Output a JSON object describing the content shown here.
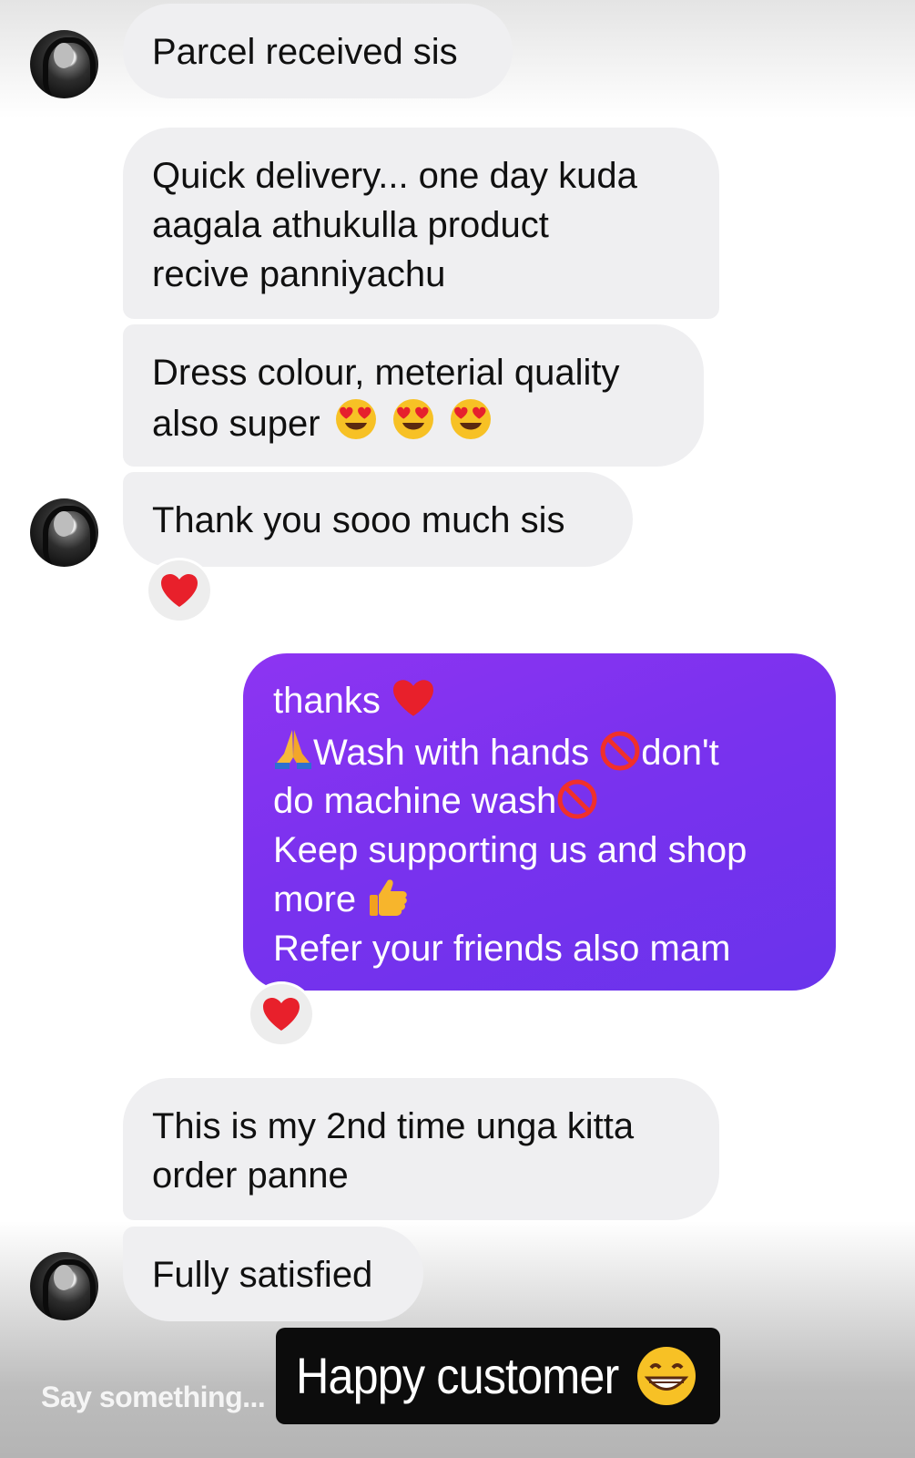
{
  "messages": {
    "m1": "Parcel received sis",
    "m2": [
      "Quick delivery... one day kuda",
      "aagala athukulla product",
      "recive panniyachu"
    ],
    "m3": [
      "Dress colour, meterial quality",
      "also super"
    ],
    "m4": "Thank you sooo much sis",
    "sent": {
      "l1": "thanks",
      "l2a": "Wash with hands",
      "l2b": "don't",
      "l3": "do machine wash",
      "l4": "Keep supporting us and shop",
      "l5": "more",
      "l6": "Refer your friends also mam"
    },
    "m5": [
      "This is my 2nd time unga kitta",
      "order panne"
    ],
    "m6": "Fully satisfied"
  },
  "reactions": {
    "m4": "red-heart",
    "sent": "red-heart"
  },
  "reply_placeholder": "Say something...",
  "caption": "Happy customer",
  "colors": {
    "sent_bubble": "#7a32ee",
    "received_bubble": "#efeff1",
    "caption_bg": "#0c0c0c"
  }
}
